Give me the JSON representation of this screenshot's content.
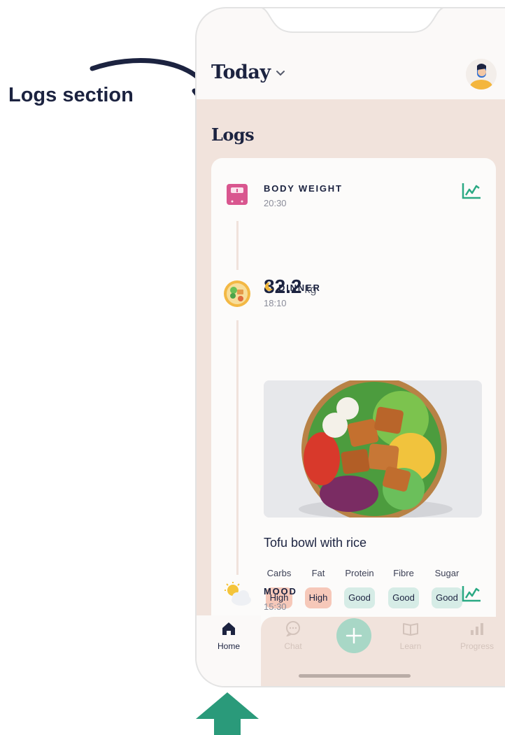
{
  "callout": {
    "text": "Logs section"
  },
  "header": {
    "title": "Today"
  },
  "logs": {
    "title": "Logs",
    "entries": {
      "weight": {
        "title": "BODY WEIGHT",
        "time": "20:30",
        "value": "82.2",
        "unit": "kg"
      },
      "dinner": {
        "title": "DINNER",
        "time": "18:10",
        "food_name": "Tofu bowl with rice",
        "nutrition": [
          {
            "label": "Carbs",
            "value": "High",
            "level": "high"
          },
          {
            "label": "Fat",
            "value": "High",
            "level": "high"
          },
          {
            "label": "Protein",
            "value": "Good",
            "level": "good"
          },
          {
            "label": "Fibre",
            "value": "Good",
            "level": "good"
          },
          {
            "label": "Sugar",
            "value": "Good",
            "level": "good"
          }
        ]
      },
      "mood": {
        "title": "MOOD",
        "time": "15:30"
      }
    }
  },
  "tabbar": {
    "tabs": [
      {
        "label": "Home",
        "icon": "home-icon",
        "active": true
      },
      {
        "label": "Chat",
        "icon": "chat-icon",
        "active": false
      },
      {
        "label": "",
        "icon": "plus-icon",
        "active": false
      },
      {
        "label": "Learn",
        "icon": "book-icon",
        "active": false
      },
      {
        "label": "Progress",
        "icon": "bar-chart-icon",
        "active": false
      }
    ]
  },
  "colors": {
    "accent_green": "#2aa983",
    "panel_bg": "#f1e3dc",
    "badge_high": "#f6c8b9",
    "badge_good": "#d6ece6",
    "text_dark": "#1c2340"
  }
}
